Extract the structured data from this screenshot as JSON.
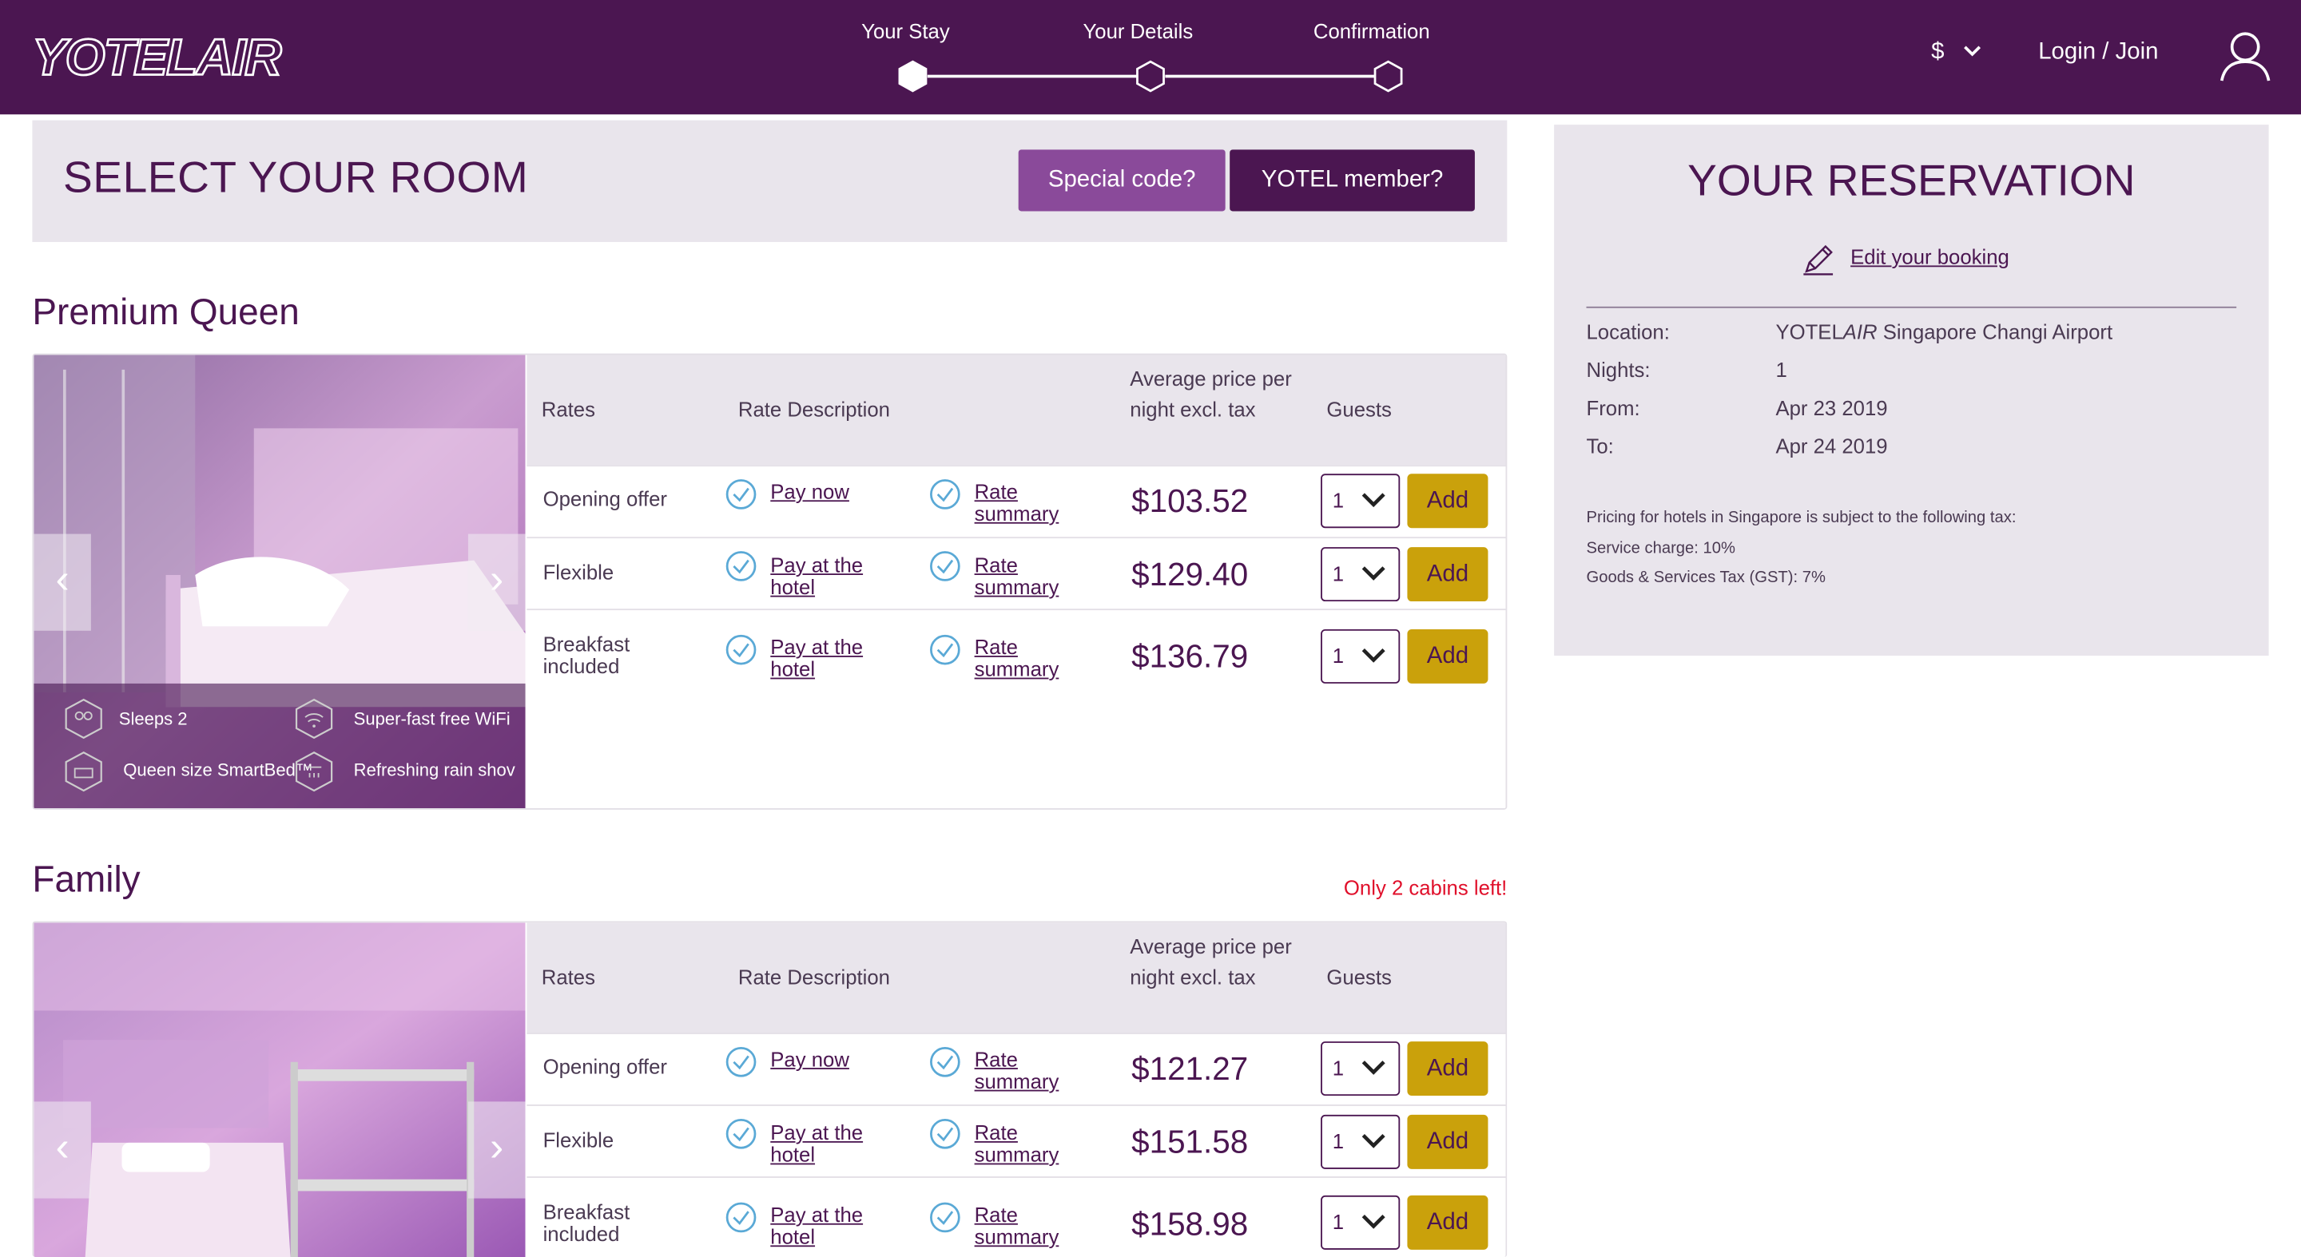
{
  "brand": {
    "logo_text": "YOTELAIR"
  },
  "steps": [
    {
      "label": "Your Stay",
      "active": true
    },
    {
      "label": "Your Details",
      "active": false
    },
    {
      "label": "Confirmation",
      "active": false
    }
  ],
  "header": {
    "currency": "$",
    "login_label": "Login / Join"
  },
  "select_room": {
    "title": "SELECT YOUR ROOM",
    "special_code_label": "Special code?",
    "member_label": "YOTEL member?"
  },
  "rate_headers": {
    "rates": "Rates",
    "description": "Rate Description",
    "price": "Average price per night excl. tax",
    "guests": "Guests"
  },
  "rooms": [
    {
      "name": "Premium Queen",
      "availability": "",
      "amenities": [
        "Sleeps 2",
        "Super-fast free WiFi",
        "Queen size SmartBed™",
        "Refreshing rain shov"
      ],
      "rates": [
        {
          "name": "Opening offer",
          "payment": "Pay now",
          "summary": "Rate summary",
          "price": "$103.52",
          "guests": "1",
          "add": "Add"
        },
        {
          "name": "Flexible",
          "payment": "Pay at the hotel",
          "summary": "Rate summary",
          "price": "$129.40",
          "guests": "1",
          "add": "Add"
        },
        {
          "name": "Breakfast included",
          "payment": "Pay at the hotel",
          "summary": "Rate summary",
          "price": "$136.79",
          "guests": "1",
          "add": "Add"
        }
      ]
    },
    {
      "name": "Family",
      "availability": "Only 2 cabins left!",
      "rates": [
        {
          "name": "Opening offer",
          "payment": "Pay now",
          "summary": "Rate summary",
          "price": "$121.27",
          "guests": "1",
          "add": "Add"
        },
        {
          "name": "Flexible",
          "payment": "Pay at the hotel",
          "summary": "Rate summary",
          "price": "$151.58",
          "guests": "1",
          "add": "Add"
        },
        {
          "name": "Breakfast included",
          "payment": "Pay at the hotel",
          "summary": "Rate summary",
          "price": "$158.98",
          "guests": "1",
          "add": "Add"
        }
      ]
    }
  ],
  "reservation": {
    "title": "YOUR RESERVATION",
    "edit_label": "Edit your booking",
    "location_label": "Location:",
    "location_brand": "YOTEL",
    "location_brand_italic": "AIR",
    "location_rest": " Singapore Changi Airport",
    "nights_label": "Nights:",
    "nights": "1",
    "from_label": "From:",
    "from": "Apr 23 2019",
    "to_label": "To:",
    "to": "Apr 24 2019",
    "tax_note": "Pricing for hotels in Singapore is subject to the following tax:",
    "service_charge": "Service charge: 10%",
    "gst": "Goods & Services Tax (GST): 7%"
  },
  "colors": {
    "brand": "#4b1651",
    "accent": "#8a4a9a",
    "add_button": "#caa10b",
    "alert": "#e0102b",
    "panel": "#e9e5ec"
  }
}
